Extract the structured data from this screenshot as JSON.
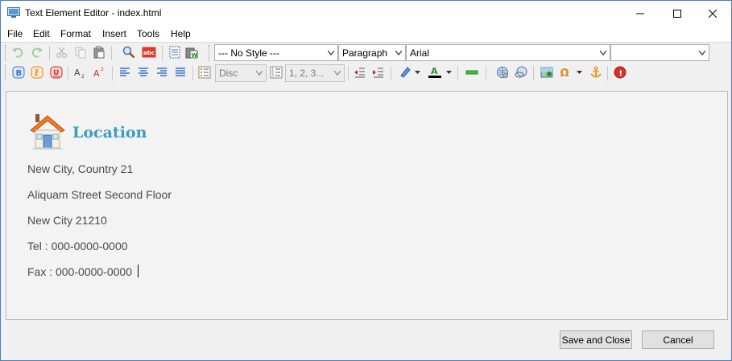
{
  "window": {
    "title": "Text Element Editor - index.html"
  },
  "menu": {
    "items": [
      "File",
      "Edit",
      "Format",
      "Insert",
      "Tools",
      "Help"
    ]
  },
  "toolbar": {
    "style_select": "--- No Style ---",
    "block_select": "Paragraph",
    "font_select": "Arial",
    "size_select": "",
    "bullet_select": "Disc",
    "numbering_select": "1, 2, 3...",
    "icons": {
      "row1": [
        "undo-icon",
        "redo-icon",
        "cut-icon",
        "copy-icon",
        "paste-icon",
        "find-icon",
        "spellcheck-icon",
        "select-all-icon",
        "paste-word-icon"
      ],
      "row2": [
        "bold-icon",
        "italic-icon",
        "underline-icon",
        "subscript-icon",
        "superscript-icon",
        "align-left-icon",
        "align-center-icon",
        "align-right-icon",
        "align-justify-icon",
        "bullet-list-icon",
        "numbered-list-icon",
        "outdent-icon",
        "indent-icon",
        "highlight-color-icon",
        "font-color-icon",
        "horizontal-rule-icon",
        "link-icon",
        "unlink-icon",
        "image-icon",
        "special-char-icon",
        "anchor-icon",
        "help-icon"
      ]
    }
  },
  "content": {
    "heading": "Location",
    "lines": [
      "New City, Country 21",
      "Aliquam Street Second Floor",
      "New City 21210",
      "Tel : 000-0000-0000",
      "Fax : 000-0000-0000"
    ]
  },
  "buttons": {
    "save": "Save and Close",
    "cancel": "Cancel"
  },
  "colors": {
    "heading": "#3a9dbf",
    "body_text": "#4a4a4a",
    "editor_bg": "#f3f3f3"
  }
}
